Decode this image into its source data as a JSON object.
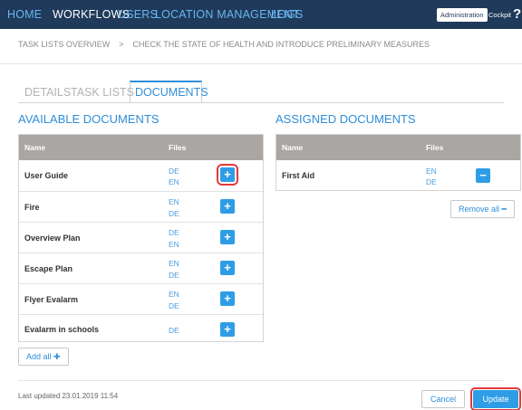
{
  "nav": {
    "items": [
      "HOME",
      "WORKFLOWS",
      "USERS",
      "LOCATION MANAGEMENT",
      "LOGS"
    ],
    "active": "WORKFLOWS",
    "admin_label": "Administration",
    "cockpit_label": "Cockpit",
    "help_label": "?"
  },
  "breadcrumb": {
    "items": [
      "TASK LISTS OVERVIEW",
      "CHECK THE STATE OF HEALTH AND INTRODUCE PRELIMINARY MEASURES"
    ],
    "separator": ">"
  },
  "tabs": {
    "items": [
      "DETAILS",
      "TASK LISTS",
      "DOCUMENTS"
    ],
    "active": "DOCUMENTS"
  },
  "available": {
    "title": "AVAILABLE DOCUMENTS",
    "col_name": "Name",
    "col_files": "Files",
    "rows": [
      {
        "name": "User Guide",
        "files": [
          "DE",
          "EN"
        ]
      },
      {
        "name": "Fire",
        "files": [
          "EN",
          "DE"
        ]
      },
      {
        "name": "Overview Plan",
        "files": [
          "DE",
          "EN"
        ]
      },
      {
        "name": "Escape Plan",
        "files": [
          "EN",
          "DE"
        ]
      },
      {
        "name": "Flyer Evalarm",
        "files": [
          "EN",
          "DE"
        ]
      },
      {
        "name": "Evalarm in schools",
        "files": [
          "DE"
        ]
      }
    ],
    "add_icon": "+",
    "add_all_label": "Add all ✚"
  },
  "assigned": {
    "title": "ASSIGNED DOCUMENTS",
    "col_name": "Name",
    "col_files": "Files",
    "rows": [
      {
        "name": "First Aid",
        "files": [
          "EN",
          "DE"
        ]
      }
    ],
    "remove_icon": "−",
    "remove_all_label": "Remove all ━"
  },
  "footer": {
    "last_updated": "Last updated 23.01.2019 11:54",
    "cancel_label": "Cancel",
    "update_label": "Update"
  },
  "colors": {
    "nav_bg": "#1f3a5a",
    "accent": "#2f8ed8",
    "button_blue": "#2f9de6",
    "header_gray": "#a9a6a3",
    "highlight_red": "#e23a3a"
  }
}
